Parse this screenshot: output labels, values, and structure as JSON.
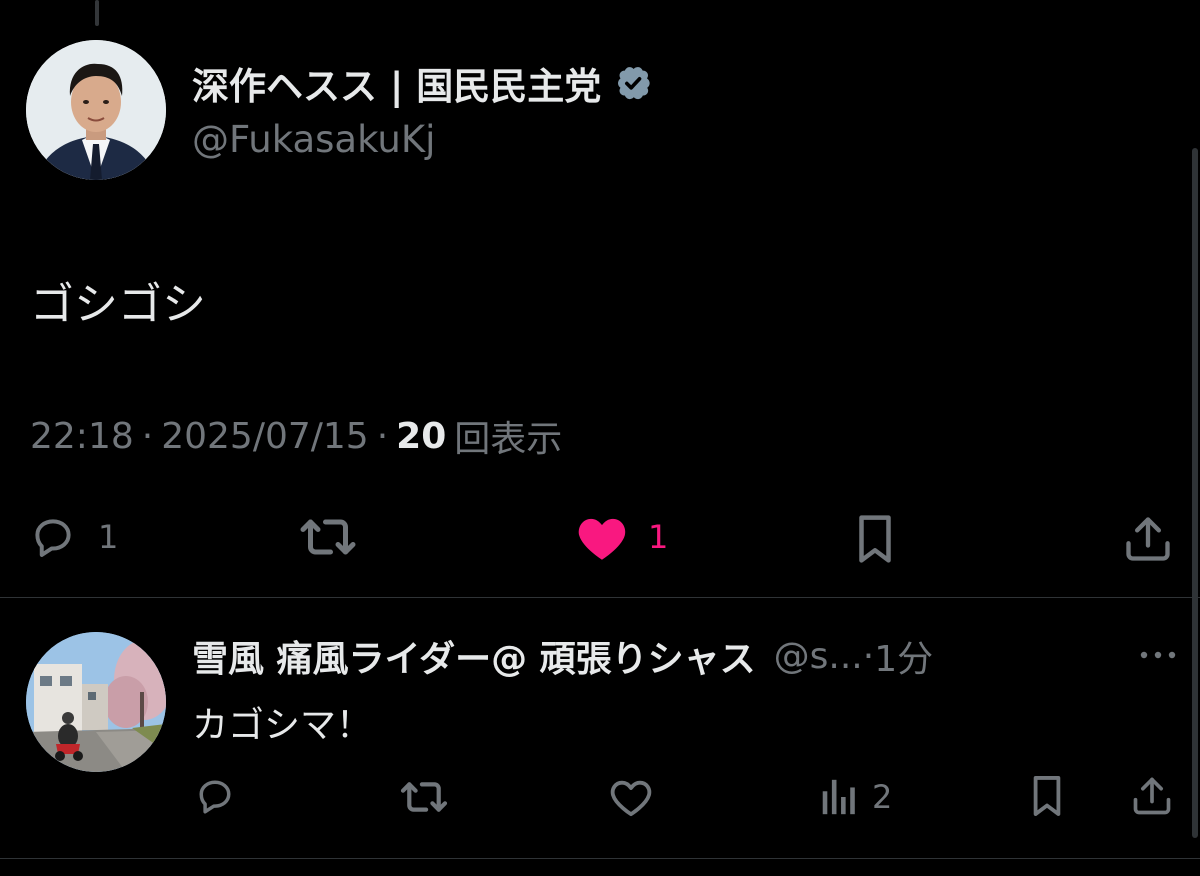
{
  "main_tweet": {
    "author_name": "深作ヘスス | 国民民主党",
    "handle": "@FukasakuKj",
    "verified": true,
    "text": "ゴシゴシ",
    "time": "22:18",
    "date": "2025/07/15",
    "separator": "·",
    "views_count": "20",
    "views_label": "回表示",
    "actions": {
      "reply_count": "1",
      "like_count": "1",
      "liked": true
    }
  },
  "reply_tweet": {
    "author_name": "雪風 痛風ライダー@ 頑張りシャス",
    "handle": "@s...",
    "separator": "·",
    "time": "1分",
    "text": "カゴシマ！",
    "actions": {
      "views_count": "2"
    }
  },
  "colors": {
    "background": "#000000",
    "text_primary": "#e7e9ea",
    "text_secondary": "#71767b",
    "like_active": "#f91880",
    "divider": "#2f3336",
    "verified_badge": "#829aab"
  },
  "icons": {
    "verified": "verified-badge-icon",
    "reply": "speech-bubble-icon",
    "retweet": "retweet-icon",
    "like": "heart-icon",
    "bookmark": "bookmark-icon",
    "share": "share-upload-icon",
    "views": "bar-chart-icon",
    "more": "more-dots-icon"
  }
}
